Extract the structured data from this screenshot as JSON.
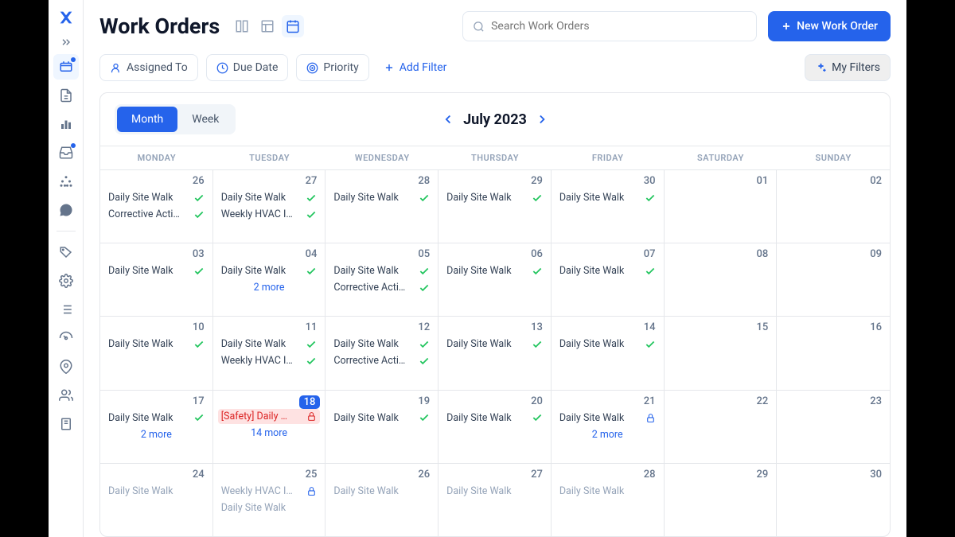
{
  "header": {
    "title": "Work Orders",
    "search_placeholder": "Search Work Orders",
    "new_button": "New Work Order"
  },
  "filters": {
    "assigned": "Assigned To",
    "due": "Due Date",
    "priority": "Priority",
    "add": "Add Filter",
    "my": "My Filters"
  },
  "calendar": {
    "month_btn": "Month",
    "week_btn": "Week",
    "label": "July 2023",
    "dow": [
      "MONDAY",
      "TUESDAY",
      "WEDNESDAY",
      "THURSDAY",
      "FRIDAY",
      "SATURDAY",
      "SUNDAY"
    ],
    "days": [
      {
        "n": "26",
        "events": [
          {
            "t": "Daily Site Walk",
            "s": "done"
          },
          {
            "t": "Corrective Acti…",
            "s": "done"
          }
        ]
      },
      {
        "n": "27",
        "events": [
          {
            "t": "Daily Site Walk",
            "s": "done"
          },
          {
            "t": "Weekly HVAC I…",
            "s": "done"
          }
        ]
      },
      {
        "n": "28",
        "events": [
          {
            "t": "Daily Site Walk",
            "s": "done"
          }
        ]
      },
      {
        "n": "29",
        "events": [
          {
            "t": "Daily Site Walk",
            "s": "done"
          }
        ]
      },
      {
        "n": "30",
        "events": [
          {
            "t": "Daily Site Walk",
            "s": "done"
          }
        ]
      },
      {
        "n": "01",
        "events": []
      },
      {
        "n": "02",
        "events": []
      },
      {
        "n": "03",
        "events": [
          {
            "t": "Daily Site Walk",
            "s": "done"
          }
        ]
      },
      {
        "n": "04",
        "events": [
          {
            "t": "Daily Site Walk",
            "s": "done"
          }
        ],
        "more": "2 more"
      },
      {
        "n": "05",
        "events": [
          {
            "t": "Daily Site Walk",
            "s": "done"
          },
          {
            "t": "Corrective Acti…",
            "s": "done"
          }
        ]
      },
      {
        "n": "06",
        "events": [
          {
            "t": "Daily Site Walk",
            "s": "done"
          }
        ]
      },
      {
        "n": "07",
        "events": [
          {
            "t": "Daily Site Walk",
            "s": "done"
          }
        ]
      },
      {
        "n": "08",
        "events": []
      },
      {
        "n": "09",
        "events": []
      },
      {
        "n": "10",
        "events": [
          {
            "t": "Daily Site Walk",
            "s": "done"
          }
        ]
      },
      {
        "n": "11",
        "events": [
          {
            "t": "Daily Site Walk",
            "s": "done"
          },
          {
            "t": "Weekly HVAC I…",
            "s": "done"
          }
        ]
      },
      {
        "n": "12",
        "events": [
          {
            "t": "Daily Site Walk",
            "s": "done"
          },
          {
            "t": "Corrective Acti…",
            "s": "done"
          }
        ]
      },
      {
        "n": "13",
        "events": [
          {
            "t": "Daily Site Walk",
            "s": "done"
          }
        ]
      },
      {
        "n": "14",
        "events": [
          {
            "t": "Daily Site Walk",
            "s": "done"
          }
        ]
      },
      {
        "n": "15",
        "events": []
      },
      {
        "n": "16",
        "events": []
      },
      {
        "n": "17",
        "events": [
          {
            "t": "Daily Site Walk",
            "s": "done"
          }
        ],
        "more": "2 more"
      },
      {
        "n": "18",
        "today": true,
        "events": [
          {
            "t": "[Safety] Daily …",
            "s": "safety"
          }
        ],
        "more": "14 more"
      },
      {
        "n": "19",
        "events": [
          {
            "t": "Daily Site Walk",
            "s": "done"
          }
        ]
      },
      {
        "n": "20",
        "events": [
          {
            "t": "Daily Site Walk",
            "s": "done"
          }
        ]
      },
      {
        "n": "21",
        "events": [
          {
            "t": "Daily Site Walk",
            "s": "lock"
          }
        ],
        "more": "2 more"
      },
      {
        "n": "22",
        "events": []
      },
      {
        "n": "23",
        "events": []
      },
      {
        "n": "24",
        "events": [
          {
            "t": "Daily Site Walk",
            "s": "future"
          }
        ]
      },
      {
        "n": "25",
        "events": [
          {
            "t": "Weekly HVAC I…",
            "s": "lockfut"
          },
          {
            "t": "Daily Site Walk",
            "s": "future"
          }
        ]
      },
      {
        "n": "26",
        "events": [
          {
            "t": "Daily Site Walk",
            "s": "future"
          }
        ]
      },
      {
        "n": "27",
        "events": [
          {
            "t": "Daily Site Walk",
            "s": "future"
          }
        ]
      },
      {
        "n": "28",
        "events": [
          {
            "t": "Daily Site Walk",
            "s": "future"
          }
        ]
      },
      {
        "n": "29",
        "events": []
      },
      {
        "n": "30",
        "events": []
      }
    ]
  }
}
